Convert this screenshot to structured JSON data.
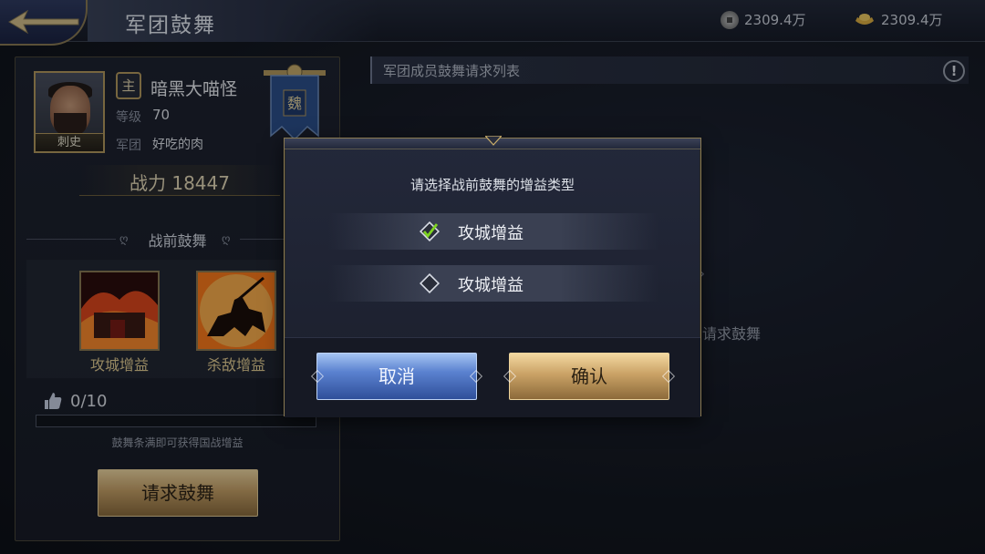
{
  "header": {
    "title": "军团鼓舞",
    "currency": [
      {
        "icon": "copper-coin-icon",
        "value": "2309.4万"
      },
      {
        "icon": "gold-ingot-icon",
        "value": "2309.4万"
      }
    ]
  },
  "player": {
    "rank": "刺史",
    "role_glyph": "主",
    "name": "暗黑大喵怪",
    "level_label": "等级",
    "level": "70",
    "legion_label": "军团",
    "legion": "好吃的肉",
    "banner_glyph": "魏",
    "power_label": "战力",
    "power": "18447"
  },
  "prebattle": {
    "section_title": "战前鼓舞",
    "skills": [
      {
        "label": "攻城增益",
        "icon": "siege-buff-icon"
      },
      {
        "label": "杀敌增益",
        "icon": "kill-buff-icon"
      }
    ],
    "likes": "0/10",
    "progress": 0,
    "hint": "鼓舞条满即可获得国战增益",
    "request_label": "请求鼓舞"
  },
  "member_list": {
    "header": "军团成员鼓舞请求列表",
    "behind_text": "请求鼓舞"
  },
  "modal": {
    "prompt": "请选择战前鼓舞的增益类型",
    "options": [
      {
        "label": "攻城增益",
        "checked": true
      },
      {
        "label": "攻城增益",
        "checked": false
      }
    ],
    "cancel_label": "取消",
    "confirm_label": "确认"
  },
  "colors": {
    "gold_accent": "#c8a165",
    "blue_button": "#5b82d0",
    "check_green": "#7ed321"
  }
}
